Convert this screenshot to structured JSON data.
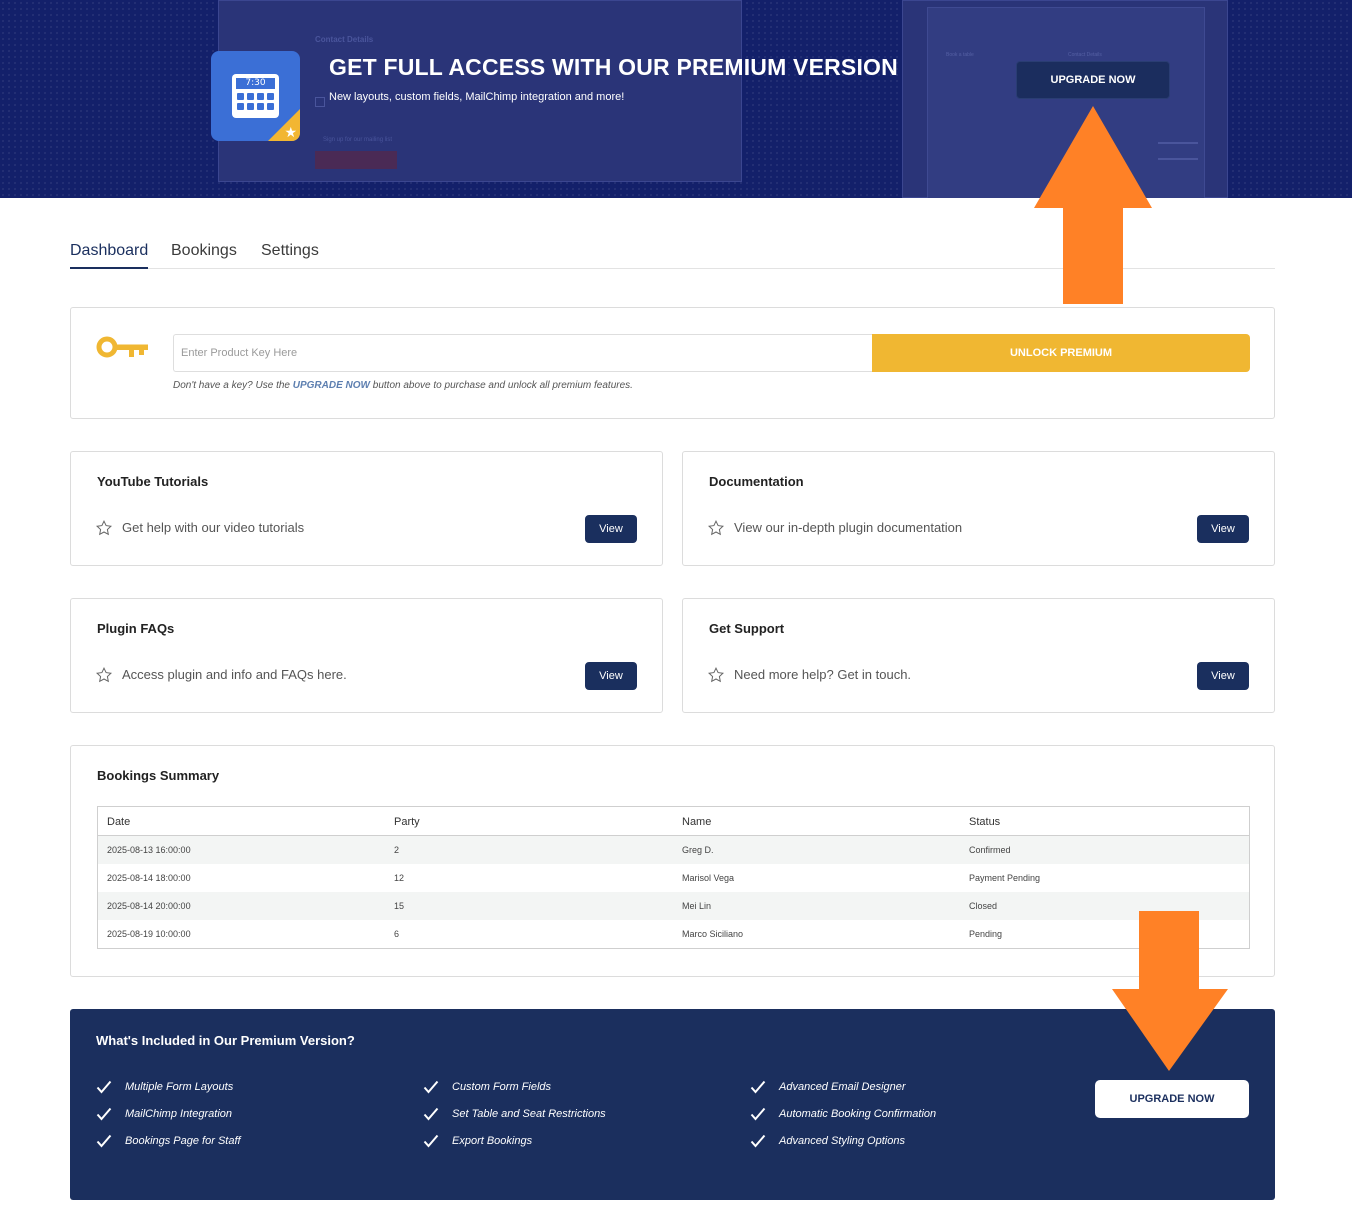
{
  "banner": {
    "title": "GET FULL ACCESS WITH OUR PREMIUM VERSION",
    "subtitle": "New layouts, custom fields, MailChimp integration and more!",
    "upgrade_label": "UPGRADE NOW",
    "icon_clock": "7:30",
    "background_color": "#13206a"
  },
  "tabs": [
    {
      "label": "Dashboard",
      "active": true
    },
    {
      "label": "Bookings",
      "active": false
    },
    {
      "label": "Settings",
      "active": false
    }
  ],
  "license": {
    "placeholder": "Enter Product Key Here",
    "value": "",
    "unlock_label": "UNLOCK PREMIUM",
    "note_before": "Don't have a key? Use the ",
    "note_highlight": "UPGRADE NOW",
    "note_after": " button above to purchase and unlock all premium features.",
    "accent_color": "#f0b732"
  },
  "resources": [
    {
      "title": "YouTube Tutorials",
      "description": "Get help with our video tutorials",
      "button": "View"
    },
    {
      "title": "Documentation",
      "description": "View our in-depth plugin documentation",
      "button": "View"
    },
    {
      "title": "Plugin FAQs",
      "description": "Access plugin and info and FAQs here.",
      "button": "View"
    },
    {
      "title": "Get Support",
      "description": "Need more help? Get in touch.",
      "button": "View"
    }
  ],
  "bookings_summary": {
    "title": "Bookings Summary",
    "columns": [
      "Date",
      "Party",
      "Name",
      "Status"
    ],
    "rows": [
      [
        "2025-08-13 16:00:00",
        "2",
        "Greg D.",
        "Confirmed"
      ],
      [
        "2025-08-14 18:00:00",
        "12",
        "Marisol Vega",
        "Payment Pending"
      ],
      [
        "2025-08-14 20:00:00",
        "15",
        "Mei Lin",
        "Closed"
      ],
      [
        "2025-08-19 10:00:00",
        "6",
        "Marco Siciliano",
        "Pending"
      ]
    ]
  },
  "premium": {
    "title": "What's Included in Our Premium Version?",
    "features": [
      [
        "Multiple Form Layouts",
        "MailChimp Integration",
        "Bookings Page for Staff"
      ],
      [
        "Custom Form Fields",
        "Set Table and Seat Restrictions",
        "Export Bookings"
      ],
      [
        "Advanced Email Designer",
        "Automatic Booking Confirmation",
        "Advanced Styling Options"
      ]
    ],
    "upgrade_label": "UPGRADE NOW",
    "panel_color": "#1b2f5e"
  },
  "colors": {
    "navy": "#1a2f5e",
    "annotation_arrow": "#ff8126"
  }
}
